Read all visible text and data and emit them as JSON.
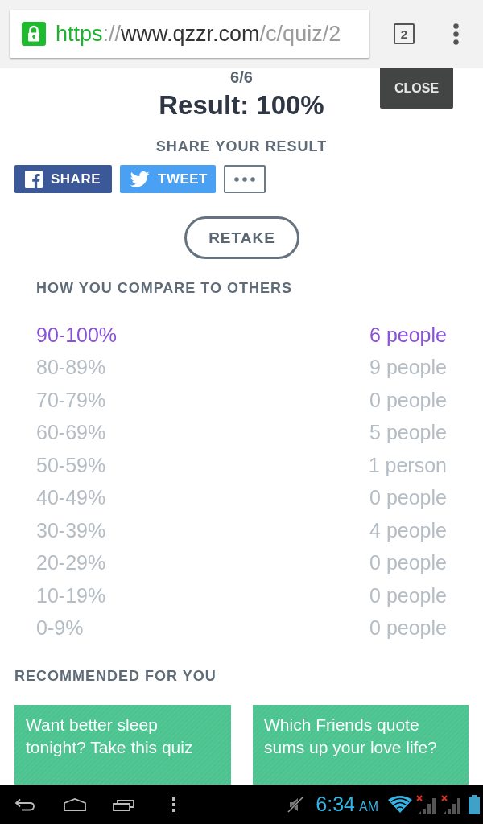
{
  "browser": {
    "url": [
      {
        "kind": "scheme",
        "text": "https"
      },
      {
        "kind": "separator",
        "text": "://"
      },
      {
        "kind": "host",
        "text": "www.qzzr.com"
      },
      {
        "kind": "path",
        "text": "/c/quiz/2"
      }
    ],
    "tab_count": "2"
  },
  "quiz": {
    "question_count": "6/6",
    "result": "Result: 100%",
    "close": "CLOSE"
  },
  "share": {
    "heading": "SHARE YOUR RESULT",
    "buttons": [
      {
        "kind": "facebook",
        "label": "SHARE"
      },
      {
        "kind": "twitter",
        "label": "TWEET"
      },
      {
        "kind": "more"
      }
    ]
  },
  "retake": "RETAKE",
  "compare": {
    "heading": "HOW YOU COMPARE TO OTHERS",
    "rows": [
      {
        "range": "90-100%",
        "count": "6 people",
        "selected": true
      },
      {
        "range": "80-89%",
        "count": "9 people",
        "selected": false
      },
      {
        "range": "70-79%",
        "count": "0 people",
        "selected": false
      },
      {
        "range": "60-69%",
        "count": "5 people",
        "selected": false
      },
      {
        "range": "50-59%",
        "count": "1 person",
        "selected": false
      },
      {
        "range": "40-49%",
        "count": "0 people",
        "selected": false
      },
      {
        "range": "30-39%",
        "count": "4 people",
        "selected": false
      },
      {
        "range": "20-29%",
        "count": "0 people",
        "selected": false
      },
      {
        "range": "10-19%",
        "count": "0 people",
        "selected": false
      },
      {
        "range": "0-9%",
        "count": "0 people",
        "selected": false
      }
    ]
  },
  "recommended": {
    "heading": "RECOMMENDED FOR YOU",
    "cards": [
      {
        "title": "Want better sleep tonight? Take this quiz"
      },
      {
        "title": "Which Friends quote sums up your love life?"
      }
    ]
  },
  "status_bar": {
    "time": "6:34",
    "meridiem": "AM"
  }
}
